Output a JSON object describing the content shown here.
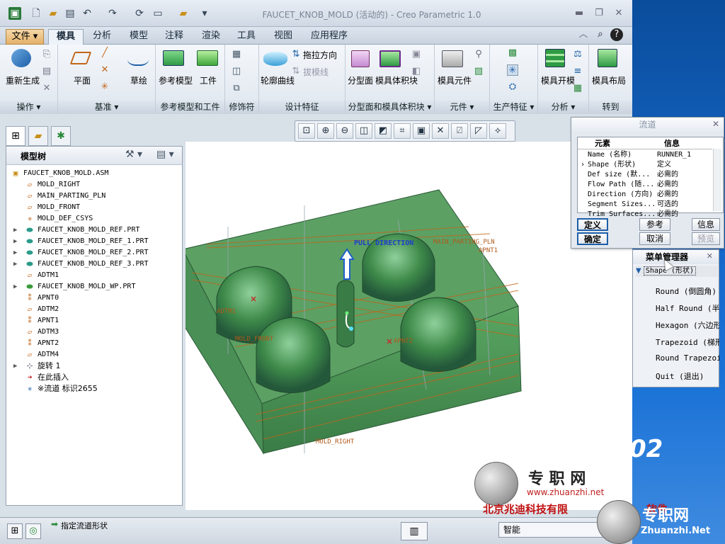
{
  "window": {
    "title": "FAUCET_KNOB_MOLD (活动的) - Creo Parametric 1.0"
  },
  "menu_tabs": [
    "文件",
    "模具",
    "分析",
    "模型",
    "注释",
    "渲染",
    "工具",
    "视图",
    "应用程序"
  ],
  "ribbon": {
    "groups": [
      {
        "label": "操作",
        "buttons": [
          "重新生成"
        ]
      },
      {
        "label": "基准",
        "buttons": [
          "平面",
          "草绘"
        ]
      },
      {
        "label": "参考模型和工件",
        "buttons": [
          "参考模型",
          "工件"
        ]
      },
      {
        "label": "修饰符",
        "buttons": []
      },
      {
        "label": "设计特征",
        "buttons": [
          "轮廓曲线",
          "拖拉方向",
          "拔模线"
        ]
      },
      {
        "label": "分型面和模具体积块",
        "buttons": [
          "分型面",
          "模具体积块"
        ]
      },
      {
        "label": "元件",
        "buttons": [
          "模具元件"
        ]
      },
      {
        "label": "生产特征",
        "buttons": []
      },
      {
        "label": "分析",
        "buttons": [
          "模具开模"
        ]
      },
      {
        "label": "转到",
        "buttons": [
          "模具布局"
        ]
      }
    ]
  },
  "model_tree": {
    "title": "模型树",
    "items": [
      {
        "label": "FAUCET_KNOB_MOLD.ASM",
        "icon": "assembly-icon",
        "expandable": false
      },
      {
        "label": "MOLD_RIGHT",
        "icon": "datum-plane-icon",
        "expandable": false
      },
      {
        "label": "MAIN_PARTING_PLN",
        "icon": "datum-plane-icon",
        "expandable": false
      },
      {
        "label": "MOLD_FRONT",
        "icon": "datum-plane-icon",
        "expandable": false
      },
      {
        "label": "MOLD_DEF_CSYS",
        "icon": "csys-icon",
        "expandable": false
      },
      {
        "label": "FAUCET_KNOB_MOLD_REF.PRT",
        "icon": "part-icon",
        "expandable": true
      },
      {
        "label": "FAUCET_KNOB_MOLD_REF_1.PRT",
        "icon": "part-icon",
        "expandable": true
      },
      {
        "label": "FAUCET_KNOB_MOLD_REF_2.PRT",
        "icon": "part-icon",
        "expandable": true
      },
      {
        "label": "FAUCET_KNOB_MOLD_REF_3.PRT",
        "icon": "part-icon",
        "expandable": true
      },
      {
        "label": "ADTM1",
        "icon": "datum-plane-icon",
        "expandable": false
      },
      {
        "label": "FAUCET_KNOB_MOLD_WP.PRT",
        "icon": "workpiece-icon",
        "expandable": true
      },
      {
        "label": "APNT0",
        "icon": "datum-point-icon",
        "expandable": false
      },
      {
        "label": "ADTM2",
        "icon": "datum-plane-icon",
        "expandable": false
      },
      {
        "label": "APNT1",
        "icon": "datum-point-icon",
        "expandable": false
      },
      {
        "label": "ADTM3",
        "icon": "datum-plane-icon",
        "expandable": false
      },
      {
        "label": "APNT2",
        "icon": "datum-point-icon",
        "expandable": false
      },
      {
        "label": "ADTM4",
        "icon": "datum-plane-icon",
        "expandable": false
      },
      {
        "label": "旋转 1",
        "icon": "revolve-icon",
        "expandable": true
      },
      {
        "label": "在此插入",
        "icon": "insert-arrow-icon",
        "expandable": false
      },
      {
        "label": "※流道 标识2655",
        "icon": "runner-icon",
        "expandable": false
      }
    ]
  },
  "viewport": {
    "labels": [
      "PULL DIRECTION",
      "MAIN_PARTING_PLN",
      "APNT1",
      "ADTM1",
      "MOLD_FRONT",
      "APNT2",
      "MOLD_RIGHT"
    ]
  },
  "status": {
    "message": "指定流道形状",
    "filter": "智能"
  },
  "runner_dialog": {
    "title": "流道",
    "headers": [
      "元素",
      "信息"
    ],
    "rows": [
      {
        "element": "Name (名称)",
        "info": "RUNNER_1"
      },
      {
        "element": "Shape (形状)",
        "info": "定义"
      },
      {
        "element": "Def size (默...",
        "info": "必需的"
      },
      {
        "element": "Flow Path (随...",
        "info": "必需的"
      },
      {
        "element": "Direction (方向)",
        "info": "必需的"
      },
      {
        "element": "Segment Sizes...",
        "info": "可选的"
      },
      {
        "element": "Trim Surfaces...",
        "info": "必需的"
      }
    ],
    "buttons": [
      "定义",
      "参考",
      "信息",
      "确定",
      "取消",
      "预览"
    ]
  },
  "menu_manager": {
    "title": "菜单管理器",
    "section": "Shape (形状)",
    "items": [
      "Round (倒圆角)",
      "Half Round (半倒圆角)",
      "Hexagon (六边形)",
      "Trapezoid (梯形)",
      "Round Trapezoid",
      "Quit (退出)"
    ]
  },
  "watermark": {
    "site_cn": "专 职 网",
    "site_url": "www.zhuanzhi.net",
    "company": "北京兆迪科技有限",
    "company_tail": "软件",
    "logo_cn": "专职网",
    "logo_url": "Zhuanzhi.Net",
    "desktop_text": "02"
  },
  "colors": {
    "mold_green": "#4f9a55",
    "accent_blue": "#1f62b8",
    "orange_datum": "#c0661a"
  }
}
